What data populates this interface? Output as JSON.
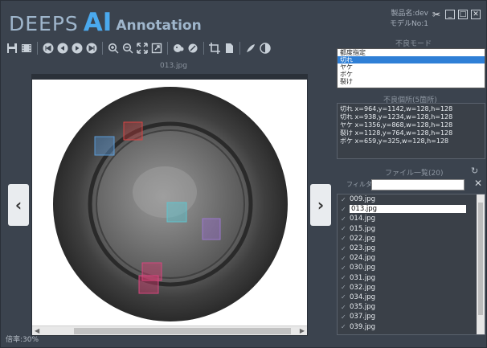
{
  "brand": {
    "deeps": "DEEPS",
    "ai": "AI",
    "annotation": "Annotation"
  },
  "meta": {
    "product": "製品名:dev",
    "model": "モデルNo:1"
  },
  "viewer": {
    "filename": "013.jpg"
  },
  "status": {
    "zoom": "倍率:30%"
  },
  "modes": {
    "title": "不良モード",
    "items": [
      "都度指定",
      "切れ",
      "ヤケ",
      "ボケ",
      "裂け"
    ],
    "selected_index": 1
  },
  "defects": {
    "title": "不良個所(5箇所)",
    "items": [
      "切れ  x=964,y=1142,w=128,h=128",
      "切れ  x=938,y=1234,w=128,h=128",
      "ヤケ  x=1356,y=868,w=128,h=128",
      "裂け  x=1128,y=764,w=128,h=128",
      "ボケ  x=659,y=325,w=128,h=128"
    ]
  },
  "files": {
    "title": "ファイル一覧(20)",
    "filter_label": "フィルタ",
    "filter_value": "",
    "items": [
      "009.jpg",
      "013.jpg",
      "014.jpg",
      "015.jpg",
      "022.jpg",
      "023.jpg",
      "024.jpg",
      "030.jpg",
      "031.jpg",
      "032.jpg",
      "034.jpg",
      "035.jpg",
      "037.jpg",
      "039.jpg"
    ],
    "selected_index": 1
  },
  "colors": {
    "accent": "#4aa9ee",
    "selection": "#2f7fd6",
    "background": "#3b434e"
  }
}
